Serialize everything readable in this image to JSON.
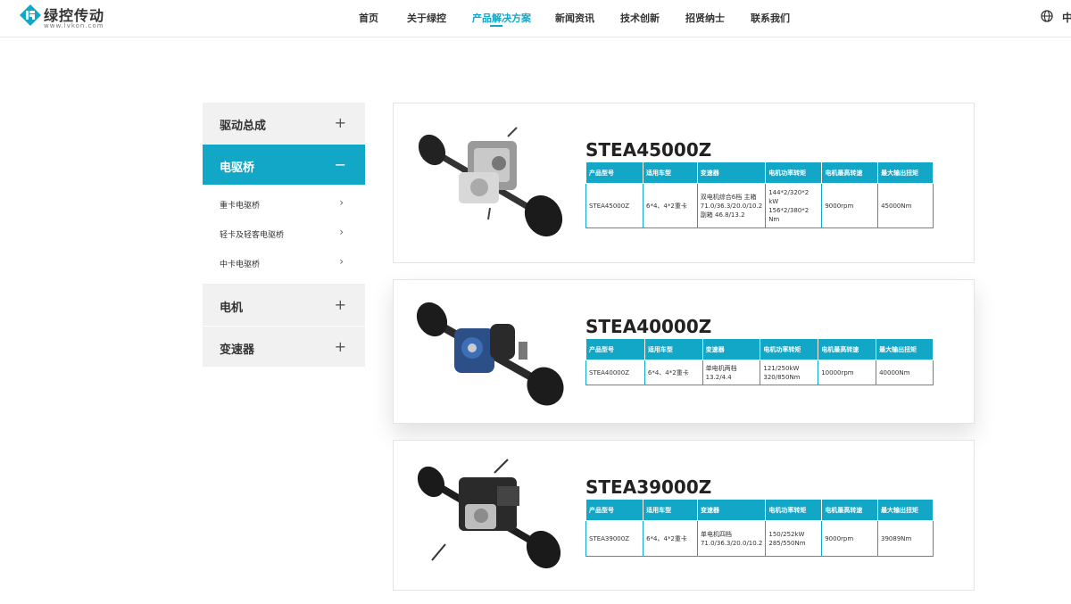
{
  "header": {
    "logo_text": "绿控传动",
    "logo_sub": "www.lvkon.com",
    "nav": [
      "首页",
      "关于绿控",
      "产品解决方案",
      "新闻资讯",
      "技术创新",
      "招贤纳士",
      "联系我们"
    ],
    "active_nav": "产品解决方案",
    "lang": "中"
  },
  "sidebar": {
    "cat1": "驱动总成",
    "cat2": "电驱桥",
    "subs": [
      "重卡电驱桥",
      "轻卡及轻客电驱桥",
      "中卡电驱桥"
    ],
    "cat3": "电机",
    "cat4": "变速器",
    "plus": "+",
    "minus": "−",
    "chev": "›"
  },
  "table_headers": [
    "产品型号",
    "适用车型",
    "变速器",
    "电机功率转矩",
    "电机最高转速",
    "最大输出扭矩"
  ],
  "products": [
    {
      "name": "STEA45000Z",
      "model": "STEA45000Z",
      "vehicle": "6*4、4*2重卡",
      "gearbox": "双电机综合6档 主箱71.0/36.3/20.0/10.2 副箱 46.8/13.2",
      "power": "144*2/320*2 kW 156*2/380*2 Nm",
      "speed": "9000rpm",
      "torque": "45000Nm"
    },
    {
      "name": "STEA40000Z",
      "model": "STEA40000Z",
      "vehicle": "6*4、4*2重卡",
      "gearbox": "单电机两档 13.2/4.4",
      "power": "121/250kW 320/850Nm",
      "speed": "10000rpm",
      "torque": "40000Nm"
    },
    {
      "name": "STEA39000Z",
      "model": "STEA39000Z",
      "vehicle": "6*4、4*2重卡",
      "gearbox": "单电机四档 71.0/36.3/20.0/10.2",
      "power": "150/252kW 285/550Nm",
      "speed": "9000rpm",
      "torque": "39089Nm"
    }
  ],
  "colors": {
    "accent": "#12a6c7",
    "sidebar_bg": "#f1f1f1"
  }
}
